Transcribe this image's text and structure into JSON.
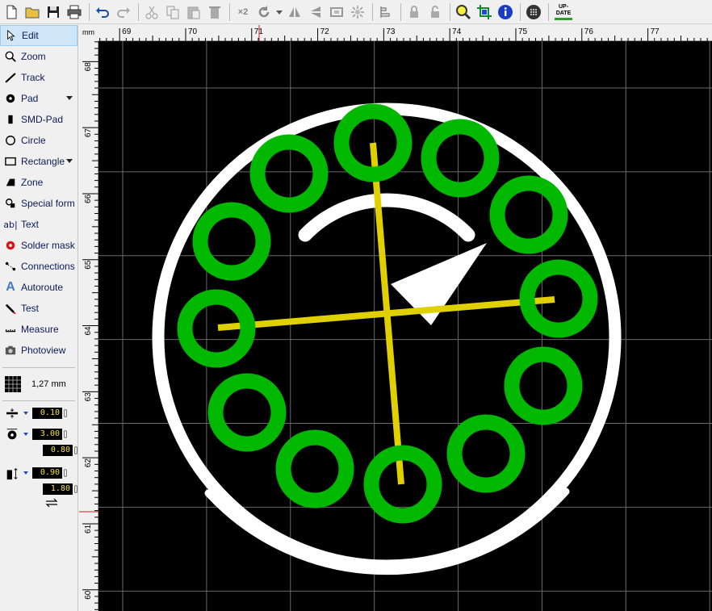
{
  "toolbar": {
    "buttons": [
      {
        "id": "new",
        "icon": "new-file-icon"
      },
      {
        "id": "open",
        "icon": "open-folder-icon"
      },
      {
        "id": "save",
        "icon": "save-icon"
      },
      {
        "id": "print",
        "icon": "print-icon"
      },
      {
        "id": "undo",
        "icon": "undo-icon"
      },
      {
        "id": "redo",
        "icon": "redo-icon"
      },
      {
        "id": "cut",
        "icon": "cut-icon"
      },
      {
        "id": "copy",
        "icon": "copy-icon"
      },
      {
        "id": "paste",
        "icon": "paste-icon"
      },
      {
        "id": "delete",
        "icon": "trash-icon"
      },
      {
        "id": "duplicate",
        "icon": "duplicate-icon"
      },
      {
        "id": "rotate",
        "icon": "rotate-icon"
      },
      {
        "id": "mirror-h",
        "icon": "mirror-horizontal-icon"
      },
      {
        "id": "mirror-v",
        "icon": "mirror-vertical-icon"
      },
      {
        "id": "group",
        "icon": "group-icon"
      },
      {
        "id": "ungroup",
        "icon": "ungroup-icon"
      },
      {
        "id": "align",
        "icon": "align-icon"
      },
      {
        "id": "lock",
        "icon": "lock-icon"
      },
      {
        "id": "unlock",
        "icon": "unlock-icon"
      },
      {
        "id": "zoom",
        "icon": "magnifier-icon"
      },
      {
        "id": "crop",
        "icon": "crop-icon"
      },
      {
        "id": "info",
        "icon": "info-icon"
      },
      {
        "id": "dots",
        "icon": "dots-icon"
      }
    ],
    "duplicate_label": "×2",
    "update_label_1": "UP-",
    "update_label_2": "DATE"
  },
  "sidebar": {
    "tools": [
      {
        "label": "Edit",
        "icon": "cursor-icon",
        "active": true
      },
      {
        "label": "Zoom",
        "icon": "zoom-icon"
      },
      {
        "label": "Track",
        "icon": "track-icon"
      },
      {
        "label": "Pad",
        "icon": "pad-icon",
        "dropdown": true
      },
      {
        "label": "SMD-Pad",
        "icon": "smd-pad-icon"
      },
      {
        "label": "Circle",
        "icon": "circle-icon"
      },
      {
        "label": "Rectangle",
        "icon": "rectangle-icon",
        "dropdown": true
      },
      {
        "label": "Zone",
        "icon": "zone-icon"
      },
      {
        "label": "Special form",
        "icon": "special-form-icon"
      },
      {
        "label": "Text",
        "icon": "text-icon"
      },
      {
        "label": "Solder mask",
        "icon": "solder-mask-icon"
      },
      {
        "label": "Connections",
        "icon": "connections-icon"
      },
      {
        "label": "Autoroute",
        "icon": "autoroute-icon"
      },
      {
        "label": "Test",
        "icon": "test-icon"
      },
      {
        "label": "Measure",
        "icon": "measure-icon"
      },
      {
        "label": "Photoview",
        "icon": "camera-icon"
      }
    ],
    "grid_value": "1,27 mm",
    "params": {
      "track_width": "0.10",
      "pad_outer": "3.00",
      "pad_inner": "0.80",
      "smd_width": "0.90",
      "smd_height": "1.80"
    }
  },
  "ruler": {
    "unit": "mm",
    "x_labels": [
      "69",
      "70",
      "71",
      "72",
      "73",
      "74",
      "75",
      "76",
      "77"
    ],
    "y_labels": [
      "68",
      "67",
      "66",
      "65",
      "64",
      "63",
      "62",
      "61",
      "60"
    ]
  },
  "colors": {
    "pad": "#00b800",
    "track": "#e0d000",
    "silk": "#ffffff",
    "grid": "#6a6a6a",
    "background": "#000000"
  }
}
